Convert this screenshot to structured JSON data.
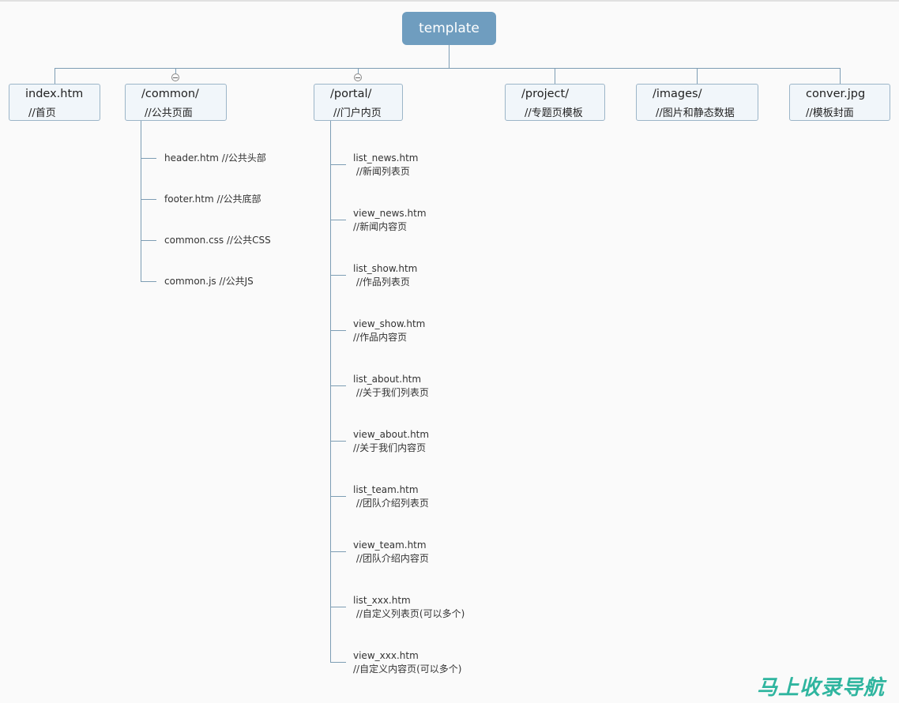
{
  "root": {
    "label": "template"
  },
  "children": [
    {
      "name": "index.htm",
      "comment": "//首页"
    },
    {
      "name": "/common/",
      "comment": "//公共页面"
    },
    {
      "name": "/portal/",
      "comment": "//门户内页"
    },
    {
      "name": "/project/",
      "comment": "//专题页模板"
    },
    {
      "name": "/images/",
      "comment": "//图片和静态数据"
    },
    {
      "name": "conver.jpg",
      "comment": "//模板封面"
    }
  ],
  "common_files": [
    {
      "text": "header.htm //公共头部"
    },
    {
      "text": "footer.htm //公共底部"
    },
    {
      "text": "common.css //公共CSS"
    },
    {
      "text": "common.js //公共JS"
    }
  ],
  "portal_files": [
    {
      "name": "list_news.htm",
      "comment": " //新闻列表页"
    },
    {
      "name": "view_news.htm",
      "comment": "//新闻内容页"
    },
    {
      "name": "list_show.htm",
      "comment": " //作品列表页"
    },
    {
      "name": "view_show.htm",
      "comment": "//作品内容页"
    },
    {
      "name": "list_about.htm",
      "comment": " //关于我们列表页"
    },
    {
      "name": "view_about.htm",
      "comment": "//关于我们内容页"
    },
    {
      "name": "list_team.htm",
      "comment": " //团队介绍列表页"
    },
    {
      "name": "view_team.htm",
      "comment": " //团队介绍内容页"
    },
    {
      "name": "list_xxx.htm",
      "comment": " //自定义列表页(可以多个)"
    },
    {
      "name": "view_xxx.htm",
      "comment": "//自定义内容页(可以多个)"
    }
  ],
  "watermark": "马上收录导航",
  "colors": {
    "root_fill": "#6f9dbf",
    "line": "#7d9db4",
    "node_fill": "#f1f6fa",
    "watermark": "#2fb59f"
  }
}
